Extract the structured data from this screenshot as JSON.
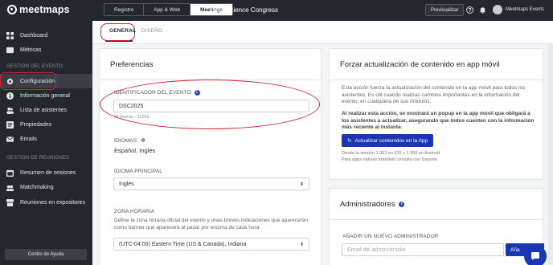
{
  "brand": {
    "name": "meetmaps"
  },
  "sidebar": {
    "items_top": [
      {
        "label": "Dashboard",
        "icon": "dashboard-icon"
      },
      {
        "label": "Métricas",
        "icon": "metrics-icon"
      }
    ],
    "section_event": "GESTION DEL EVENTO",
    "items_event": [
      {
        "label": "Configuración",
        "icon": "gear-icon",
        "active": true
      },
      {
        "label": "Información general",
        "icon": "info-icon"
      },
      {
        "label": "Lista de asistentes",
        "icon": "users-icon"
      },
      {
        "label": "Propiedades",
        "icon": "properties-icon"
      },
      {
        "label": "Emails",
        "icon": "mail-icon"
      }
    ],
    "section_meetings": "GESTION DE REUNIONES",
    "items_meetings": [
      {
        "label": "Resumen de sesiones",
        "icon": "sessions-icon"
      },
      {
        "label": "Matchmaking",
        "icon": "matchmaking-icon"
      },
      {
        "label": "Reuniones en expositores",
        "icon": "exhibitor-icon"
      }
    ],
    "help": "Centro de Ayuda"
  },
  "topbar": {
    "tabs": [
      "Registro",
      "App & Web",
      "Meetings"
    ],
    "active_tab": "Meetings",
    "event_name": "Data Science Congress",
    "preview": "Previsualizar",
    "user": "Meetmaps Events"
  },
  "subtabs": {
    "general": "GENERAL",
    "design": "DISEÑO"
  },
  "preferences": {
    "title": "Preferencias",
    "identifier_label": "IDENTIFICADOR DEL EVENTO",
    "identifier_value": "DSC2025",
    "internal_id": "ID interno - 11269",
    "languages_label": "IDIOMAS",
    "languages_value": "Español, Inglés",
    "main_language_label": "IDIOMA PRINCIPAL",
    "main_language_value": "Inglés",
    "timezone_label": "ZONA HORARIA",
    "timezone_desc": "Define la zona horaria oficial del evento y unas breves indicaciones que aparecerán como banner que aparecerá al pasar por encima de cada hora",
    "timezone_value": "(UTC-04:00) Eastern Time (US & Canada), Indiana"
  },
  "force_update": {
    "title": "Forzar actualización de contenido en app móvil",
    "desc": "Esta acción fuerza la actualización del contenido en la app móvil para todos los asistentes. Es útil cuando realizas cambios importantes en la información del evento, en cualquiera de sus módulos.",
    "warning": "Al realizar esta acción, se mostrará un popup en la app móvil que obligará a los asistentes a actualizar, asegurando que todos cuenten con la información más reciente al instante.",
    "button": "Actualizar contenidos en la App",
    "note1": "Desde la versión 1.363 en iOS y 1.359 en Android",
    "note2": "Para apps nativas branded consulta con Soporte"
  },
  "admins": {
    "title": "Administradores",
    "add_label": "AÑADIR UN NUEVO ADMINISTRADOR",
    "email_placeholder": "Email del administrador",
    "add_button": "Aña"
  },
  "colors": {
    "sidebar": "#25272e",
    "primary": "#1a36b4",
    "highlight": "#d4202f"
  }
}
